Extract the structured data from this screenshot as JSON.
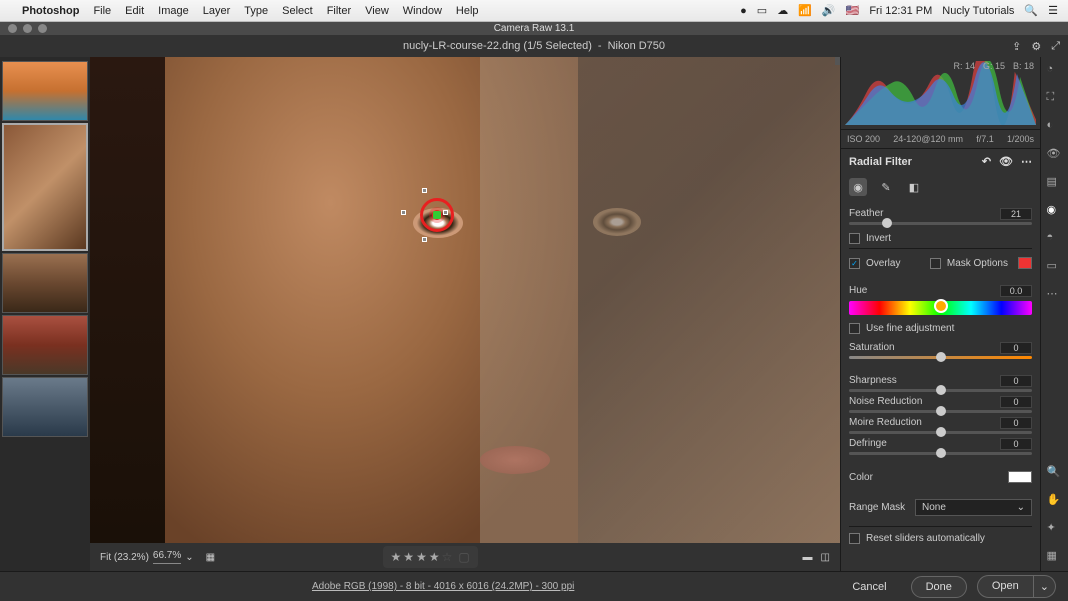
{
  "menubar": {
    "apple": "",
    "app_name": "Photoshop",
    "items": [
      "File",
      "Edit",
      "Image",
      "Layer",
      "Type",
      "Select",
      "Filter",
      "View",
      "Window",
      "Help"
    ],
    "clock": "Fri 12:31 PM",
    "user": "Nucly Tutorials"
  },
  "window": {
    "title": "Camera Raw 13.1",
    "filename": "nucly-LR-course-22.dng (1/5 Selected)",
    "camera": "Nikon D750"
  },
  "histogram": {
    "r": "R: 14",
    "g": "G: 15",
    "b": "B: 18",
    "iso": "ISO 200",
    "lens": "24-120@120 mm",
    "aperture": "f/7.1",
    "shutter": "1/200s"
  },
  "panel": {
    "title": "Radial Filter",
    "feather": {
      "label": "Feather",
      "value": "21",
      "pos": 21
    },
    "invert": {
      "label": "Invert",
      "checked": false
    },
    "overlay": {
      "label": "Overlay",
      "checked": true
    },
    "mask_options": {
      "label": "Mask Options",
      "checked": false
    },
    "hue": {
      "label": "Hue",
      "value": "0.0"
    },
    "fine_adj": {
      "label": "Use fine adjustment",
      "checked": false
    },
    "saturation": {
      "label": "Saturation",
      "value": "0"
    },
    "sharpness": {
      "label": "Sharpness",
      "value": "0"
    },
    "noise": {
      "label": "Noise Reduction",
      "value": "0"
    },
    "moire": {
      "label": "Moire Reduction",
      "value": "0"
    },
    "defringe": {
      "label": "Defringe",
      "value": "0"
    },
    "color_label": "Color",
    "range_mask": {
      "label": "Range Mask",
      "value": "None"
    },
    "reset": {
      "label": "Reset sliders automatically",
      "checked": false
    }
  },
  "footer": {
    "fit": "Fit (23.2%)",
    "zoom": "66.7%",
    "profile_link": "Adobe RGB (1998) - 8 bit - 4016 x 6016 (24.2MP) - 300 ppi",
    "cancel": "Cancel",
    "done": "Done",
    "open": "Open"
  },
  "rating": 4
}
